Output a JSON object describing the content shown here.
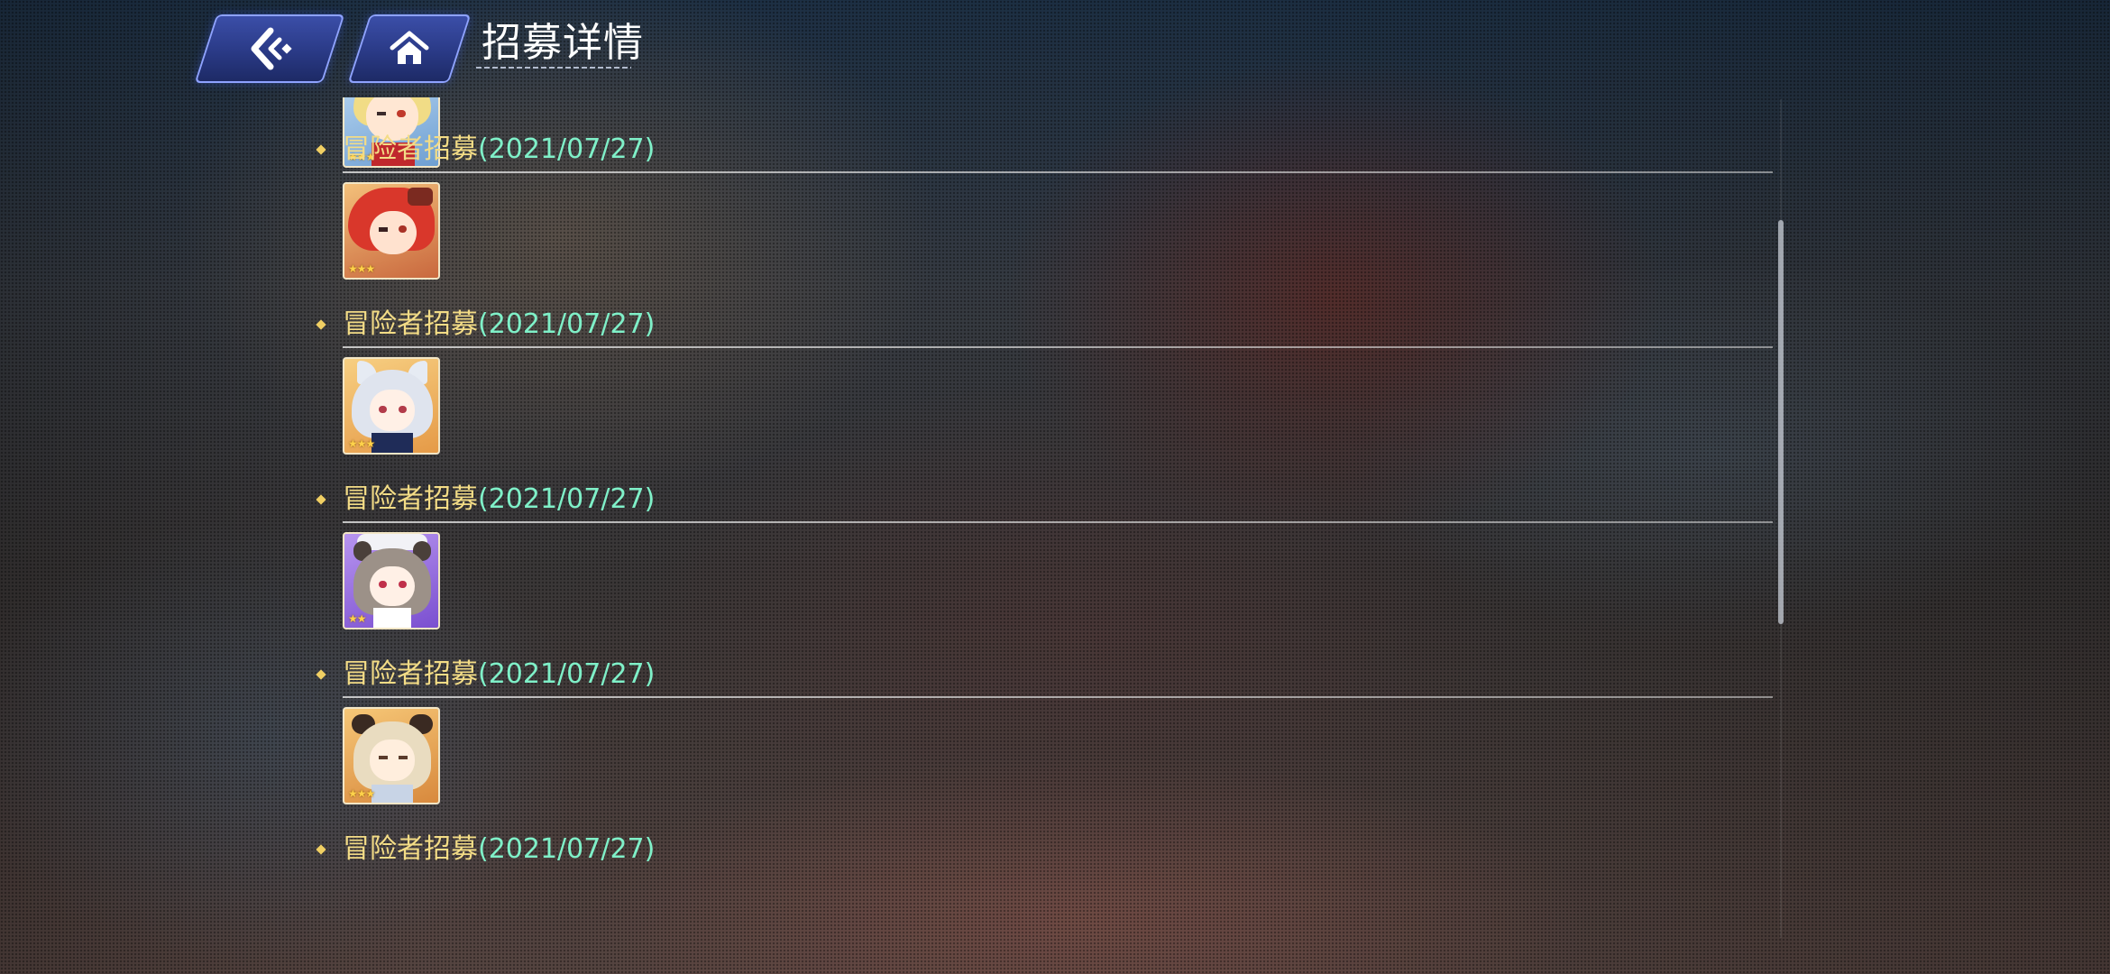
{
  "header": {
    "back_icon": "back-arrow-icon",
    "home_icon": "home-icon",
    "title": "招募详情"
  },
  "entries": [
    {
      "name": "冒险者招募",
      "date": "(2021/07/27)",
      "stars": "★★★",
      "portrait_bg": "#9fc4e8",
      "hair": "#f1dc86"
    },
    {
      "name": "冒险者招募",
      "date": "(2021/07/27)",
      "stars": "★★★",
      "portrait_bg": "#e8a85e",
      "hair": "#d9372b"
    },
    {
      "name": "冒险者招募",
      "date": "(2021/07/27)",
      "stars": "★★★",
      "portrait_bg": "#f0b866",
      "hair": "#dfe4ee"
    },
    {
      "name": "冒险者招募",
      "date": "(2021/07/27)",
      "stars": "★★",
      "portrait_bg": "#a173e0",
      "hair": "#9c9188"
    },
    {
      "name": "冒险者招募",
      "date": "(2021/07/27)",
      "stars": "★★★",
      "portrait_bg": "#efb55c",
      "hair": "#e9dcc0"
    },
    {
      "name": "冒险者招募",
      "date": "(2021/07/27)",
      "stars": "",
      "portrait_bg": "",
      "hair": ""
    }
  ],
  "colors": {
    "name": "#f3dc86",
    "date": "#7ff0c8",
    "button": "#2a3a86"
  }
}
